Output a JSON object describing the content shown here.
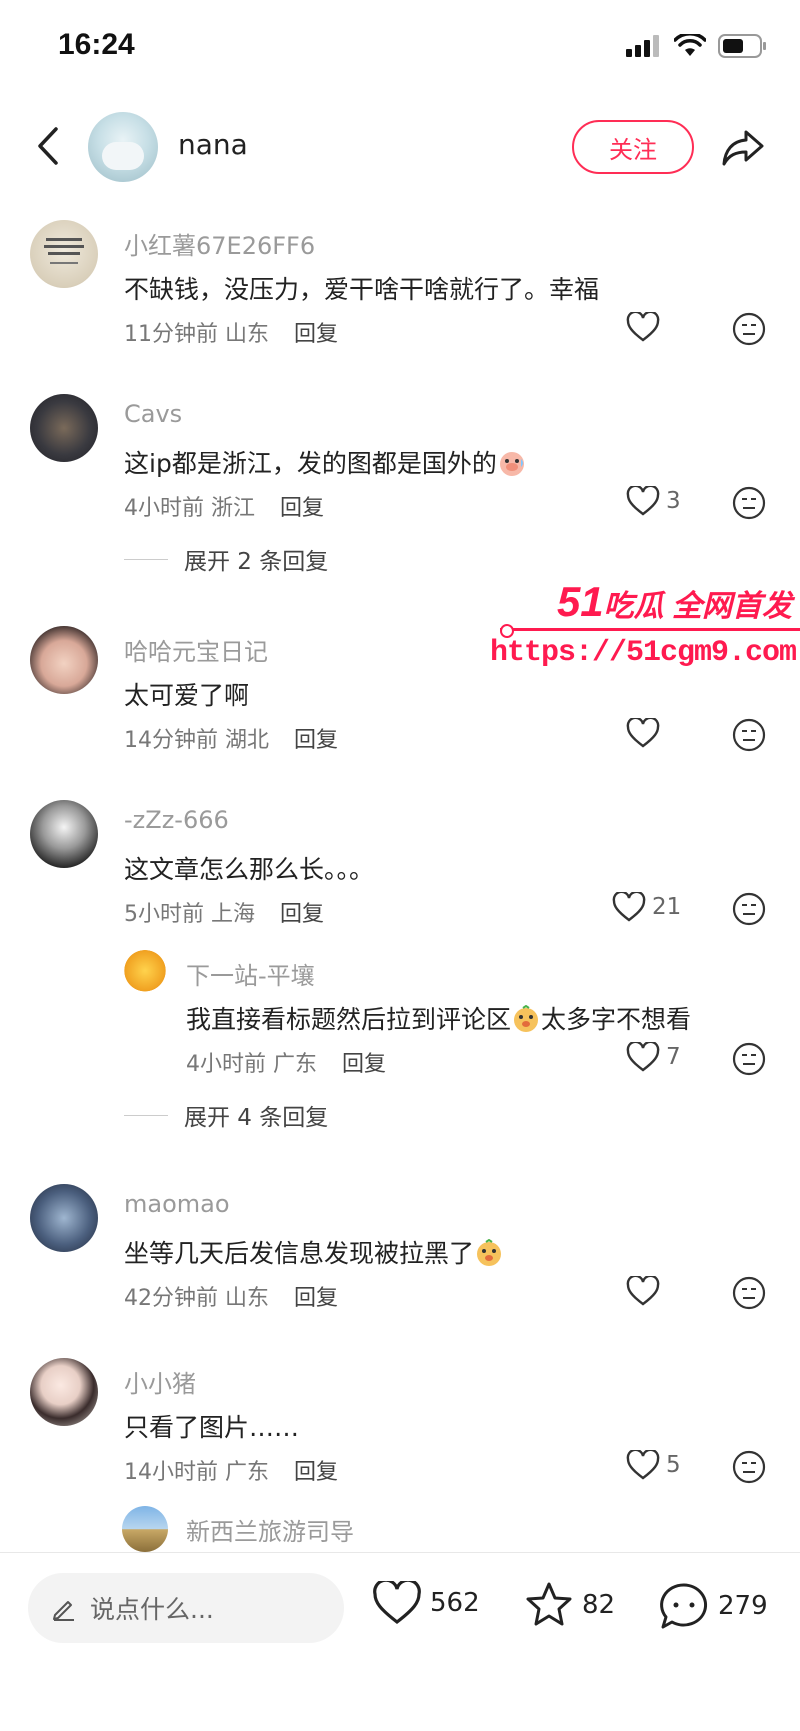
{
  "status_bar": {
    "time": "16:24"
  },
  "header": {
    "username": "nana",
    "follow_label": "关注"
  },
  "watermark": {
    "brand_num": "51",
    "brand_text": "吃瓜 全网首发",
    "url": "https://51cgm9.com"
  },
  "comments": [
    {
      "name": "小红薯67E26FF6",
      "text": "不缺钱，没压力，爱干啥干啥就行了。幸福",
      "time": "11分钟前",
      "location": "山东",
      "reply": "回复",
      "likes": ""
    },
    {
      "name": "Cavs",
      "text": "这ip都是浙江，发的图都是国外的",
      "time": "4小时前",
      "location": "浙江",
      "reply": "回复",
      "likes": "3",
      "expand": "展开 2 条回复"
    },
    {
      "name": "哈哈元宝日记",
      "text": "太可爱了啊",
      "time": "14分钟前",
      "location": "湖北",
      "reply": "回复",
      "likes": ""
    },
    {
      "name": "-zZz-666",
      "text": "这文章怎么那么长。。。",
      "time": "5小时前",
      "location": "上海",
      "reply": "回复",
      "likes": "21",
      "expand": "展开 4 条回复",
      "sub_reply": {
        "name": "下一站-平壤",
        "text_a": "我直接看标题然后拉到评论区",
        "text_b": "太多字不想看",
        "time": "4小时前",
        "location": "广东",
        "reply": "回复",
        "likes": "7"
      }
    },
    {
      "name": "maomao",
      "text": "坐等几天后发信息发现被拉黑了",
      "time": "42分钟前",
      "location": "山东",
      "reply": "回复",
      "likes": ""
    },
    {
      "name": "小小猪",
      "text": "只看了图片……",
      "time": "14小时前",
      "location": "广东",
      "reply": "回复",
      "likes": "5",
      "sub_reply": {
        "name": "新西兰旅游司导"
      }
    }
  ],
  "bottom_bar": {
    "input_placeholder": "说点什么...",
    "likes": "562",
    "favorites": "82",
    "comments": "279"
  },
  "colors": {
    "accent": "#ff2d55",
    "watermark": "#ff1a4f",
    "meta_gray": "#9a9a9a"
  }
}
